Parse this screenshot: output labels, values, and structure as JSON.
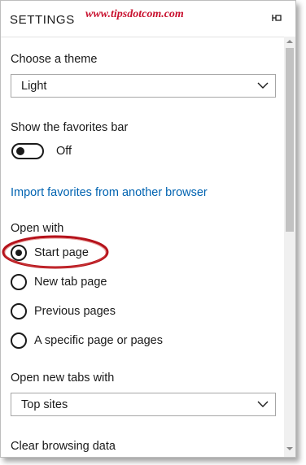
{
  "header": {
    "title": "SETTINGS",
    "watermark": "www.tipsdotcom.com",
    "pin_icon": "pin-icon"
  },
  "theme": {
    "label": "Choose a theme",
    "value": "Light"
  },
  "favorites_bar": {
    "label": "Show the favorites bar",
    "state": "Off"
  },
  "import_link": "Import favorites from another browser",
  "open_with": {
    "label": "Open with",
    "options": [
      "Start page",
      "New tab page",
      "Previous pages",
      "A specific page or pages"
    ],
    "selected": "Start page"
  },
  "new_tabs": {
    "label": "Open new tabs with",
    "value": "Top sites"
  },
  "clear_browsing": {
    "label": "Clear browsing data"
  },
  "colors": {
    "accent_link": "#0063b1",
    "highlight_ellipse": "#b5121b"
  }
}
